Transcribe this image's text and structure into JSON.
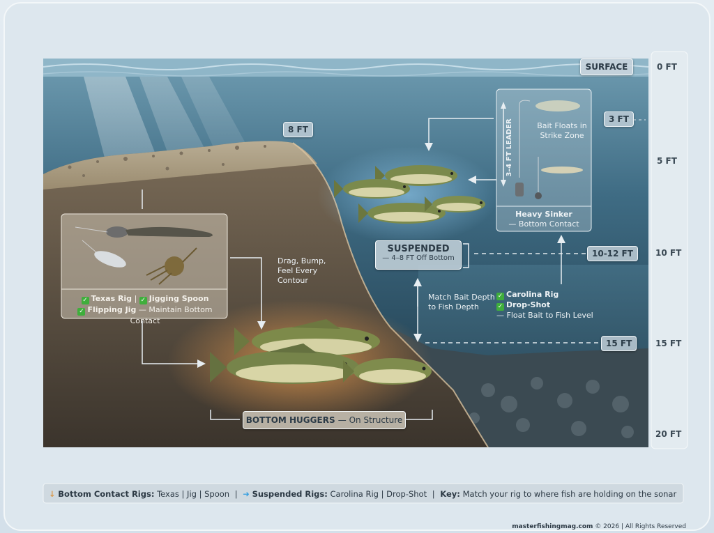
{
  "surface_label": "SURFACE",
  "depth_scale": [
    "0 FT",
    "5 FT",
    "10 FT",
    "15 FT",
    "20 FT"
  ],
  "depth_tags": {
    "eight": "8 FT",
    "three": "3 FT",
    "ten_twelve": "10-12 FT",
    "fifteen": "15 FT"
  },
  "bottom_rigs": {
    "texas": "Texas Rig",
    "spoon": "Jigging Spoon",
    "jig": "Flipping Jig",
    "tail": "— Maintain Bottom Contact",
    "sep": "|"
  },
  "drag_note": [
    "Drag, Bump,",
    "Feel Every",
    "Contour"
  ],
  "bottom_huggers": {
    "title": "BOTTOM HUGGERS",
    "tail": "— On Structure"
  },
  "suspended": {
    "title": "SUSPENDED",
    "sub": "— 4–8 FT Off Bottom"
  },
  "match_note": [
    "Match Bait Depth",
    "to Fish Depth"
  ],
  "carolina": {
    "leader": "3–4 FT LEADER",
    "floats": [
      "Bait Floats in",
      "Strike Zone"
    ],
    "sinker_title": "Heavy Sinker",
    "sinker_sub": "— Bottom Contact"
  },
  "suspended_rigs": {
    "carolina": "Carolina Rig",
    "drop": "Drop-Shot",
    "tail": "— Float Bait to Fish Level"
  },
  "legend": {
    "bottom_label": "Bottom Contact Rigs:",
    "bottom_items": "Texas | Jig | Spoon",
    "susp_label": "Suspended Rigs:",
    "susp_items": "Carolina Rig | Drop-Shot",
    "key_label": "Key:",
    "key_text": "Match your rig to where fish are holding on the sonar",
    "sep": "|"
  },
  "copyright": {
    "site": "masterfishingmag.com",
    "rest": "© 2026 | All Rights Reserved"
  },
  "colors": {
    "water_top": "#5f8ea4",
    "water_bottom": "#1d3b4c",
    "sand": "#a89a80",
    "fish": "#7d8a4a",
    "check": "#3fae3c",
    "arrow_blue": "#3aa0e0",
    "arrow_orange": "#d89a50"
  }
}
